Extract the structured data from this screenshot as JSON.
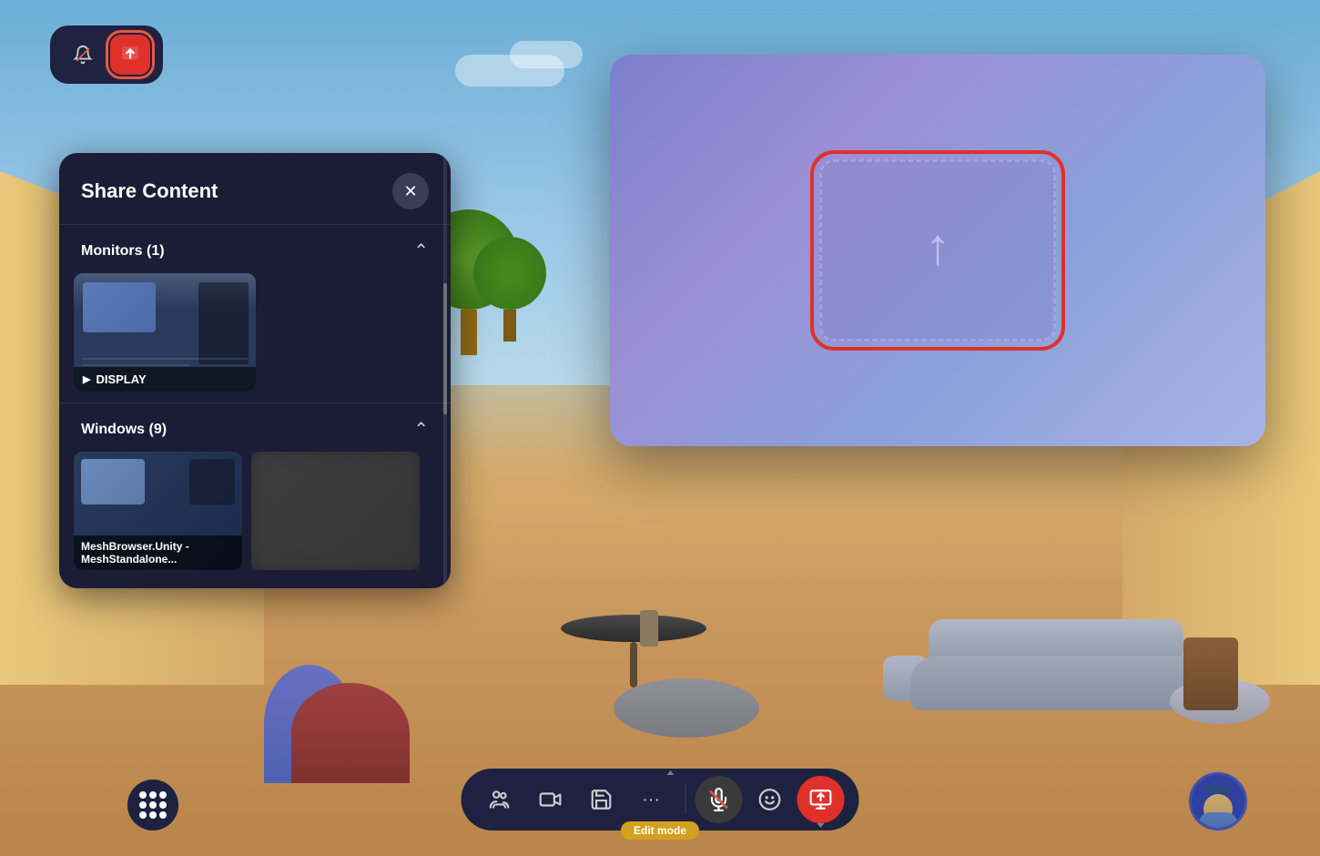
{
  "scene": {
    "sky_color": "#87CEEB",
    "floor_color": "#d4a96a"
  },
  "top_toolbar": {
    "notification_icon": "🔔",
    "upload_icon": "⬆",
    "active_button": "upload"
  },
  "share_panel": {
    "title": "Share Content",
    "close_label": "✕",
    "monitors_section": {
      "label": "Monitors (1)",
      "count": 1,
      "items": [
        {
          "id": "monitor-1",
          "label": "DISPLAY",
          "icon": "▶"
        }
      ]
    },
    "windows_section": {
      "label": "Windows (9)",
      "count": 9,
      "items": [
        {
          "id": "window-1",
          "label": "MeshBrowser.Unity - MeshStandalone..."
        },
        {
          "id": "window-2",
          "label": ""
        }
      ]
    }
  },
  "vr_screen": {
    "upload_arrow": "↑"
  },
  "bottom_toolbar": {
    "buttons": [
      {
        "id": "people",
        "icon": "👥",
        "label": "people"
      },
      {
        "id": "film",
        "icon": "🎬",
        "label": "film"
      },
      {
        "id": "save",
        "icon": "💾",
        "label": "save"
      },
      {
        "id": "more",
        "icon": "···",
        "label": "more"
      },
      {
        "id": "mute",
        "icon": "🎤",
        "label": "mute",
        "state": "muted"
      },
      {
        "id": "emoji",
        "icon": "🙂",
        "label": "emoji"
      },
      {
        "id": "share",
        "icon": "📱",
        "label": "share-screen",
        "state": "active"
      }
    ],
    "edit_mode_label": "Edit mode"
  },
  "dots_grid": {
    "label": "apps-grid"
  },
  "avatar": {
    "label": "user-avatar"
  }
}
